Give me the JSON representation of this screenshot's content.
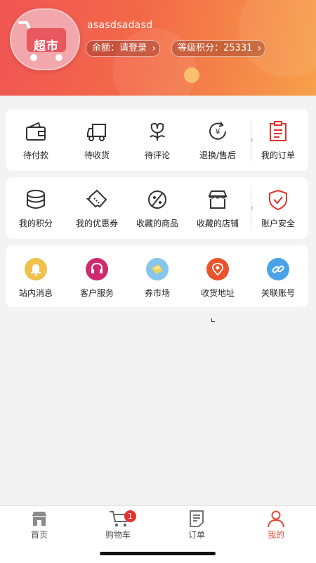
{
  "profile": {
    "avatar_text": "超市",
    "username": "asasdsadasd",
    "balance_label": "余额：请登录",
    "points_label": "等级积分：25331"
  },
  "orders": {
    "items": [
      {
        "label": "待付款",
        "icon": "wallet-icon"
      },
      {
        "label": "待收货",
        "icon": "delivery-truck-icon"
      },
      {
        "label": "待评论",
        "icon": "flower-icon"
      },
      {
        "label": "退换/售后",
        "icon": "refund-icon"
      },
      {
        "label": "我的订单",
        "icon": "order-list-icon"
      }
    ]
  },
  "assets": {
    "items": [
      {
        "label": "我的积分",
        "icon": "points-stack-icon"
      },
      {
        "label": "我的优惠券",
        "icon": "coupon-ticket-icon"
      },
      {
        "label": "收藏的商品",
        "icon": "favorite-goods-icon"
      },
      {
        "label": "收藏的店铺",
        "icon": "favorite-store-icon"
      },
      {
        "label": "账户安全",
        "icon": "security-shield-icon"
      }
    ]
  },
  "services": {
    "items": [
      {
        "label": "站内消息",
        "icon": "bell-icon",
        "color": "#f0c14b"
      },
      {
        "label": "客户服务",
        "icon": "headset-icon",
        "color": "#cf2a6e"
      },
      {
        "label": "券市场",
        "icon": "coupon-market-icon",
        "color": "#86c6ee"
      },
      {
        "label": "收货地址",
        "icon": "location-icon",
        "color": "#e9542c"
      },
      {
        "label": "关联账号",
        "icon": "link-icon",
        "color": "#4aa3e8"
      }
    ]
  },
  "tabbar": {
    "items": [
      {
        "label": "首页",
        "icon": "home-store-icon"
      },
      {
        "label": "购物车",
        "icon": "cart-icon",
        "badge": "1"
      },
      {
        "label": "订单",
        "icon": "order-icon"
      },
      {
        "label": "我的",
        "icon": "profile-icon",
        "active": true
      }
    ]
  },
  "colors": {
    "accent": "#e24a3b",
    "header_start": "#f05553",
    "header_end": "#f7a04a"
  }
}
